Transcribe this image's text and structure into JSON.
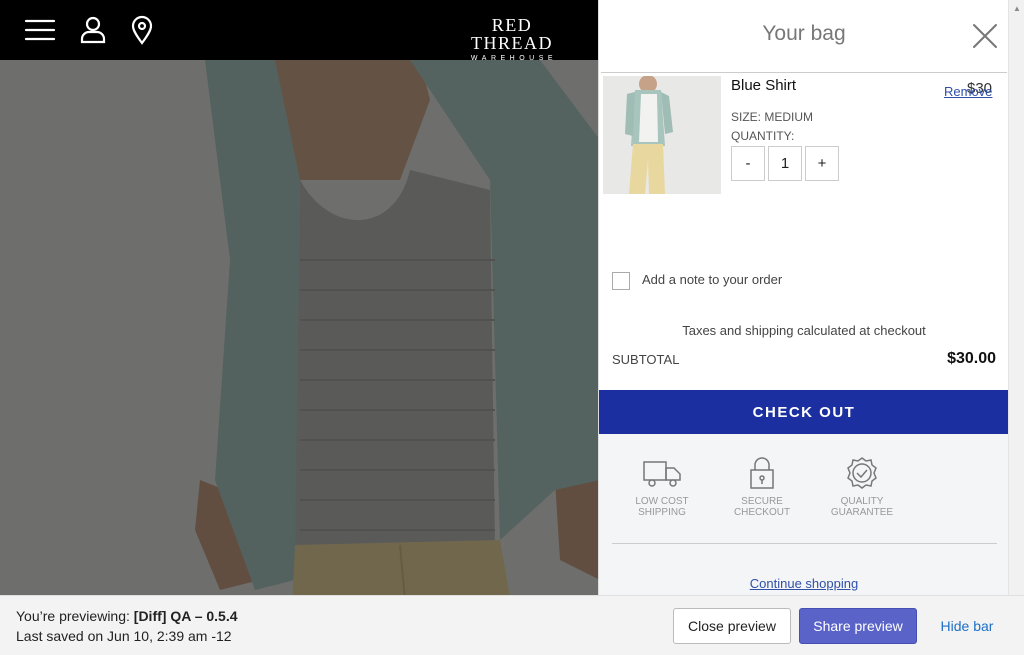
{
  "header": {
    "menu_icon": "hamburger-icon",
    "account_icon": "user-icon",
    "location_icon": "map-pin-icon",
    "logo_main": "RED THREAD",
    "logo_sub": "WAREHOUSE"
  },
  "cart": {
    "title": "Your bag",
    "close_icon": "close-icon",
    "item": {
      "name": "Blue Shirt",
      "price": "$30",
      "remove_label": "Remove",
      "size": "SIZE: MEDIUM",
      "quantity_label": "QUANTITY:",
      "decrement_label": "-",
      "quantity": "1",
      "increment_label": "+"
    },
    "note_label": "Add a note to your order",
    "tax_note": "Taxes and shipping calculated at checkout",
    "subtotal_label": "SUBTOTAL",
    "subtotal_value": "$30.00",
    "checkout_label": "CHECK OUT",
    "trust": [
      {
        "icon": "truck-icon",
        "line1": "LOW COST",
        "line2": "SHIPPING"
      },
      {
        "icon": "lock-icon",
        "line1": "SECURE",
        "line2": "CHECKOUT"
      },
      {
        "icon": "badge-check-icon",
        "line1": "QUALITY",
        "line2": "GUARANTEE"
      }
    ],
    "continue_label": "Continue shopping"
  },
  "preview_bar": {
    "previewing_prefix": "You’re previewing: ",
    "theme_name": "[Diff] QA – 0.5.4",
    "last_saved": "Last saved on Jun 10, 2:39 am -12",
    "close_preview": "Close preview",
    "share_preview": "Share preview",
    "hide_bar": "Hide bar"
  },
  "colors": {
    "header_bg": "#000000",
    "checkout_bg": "#1b2fa0",
    "share_btn_bg": "#5a63c8",
    "link": "#3050a8",
    "hide_bar_link": "#1c6fc7"
  }
}
